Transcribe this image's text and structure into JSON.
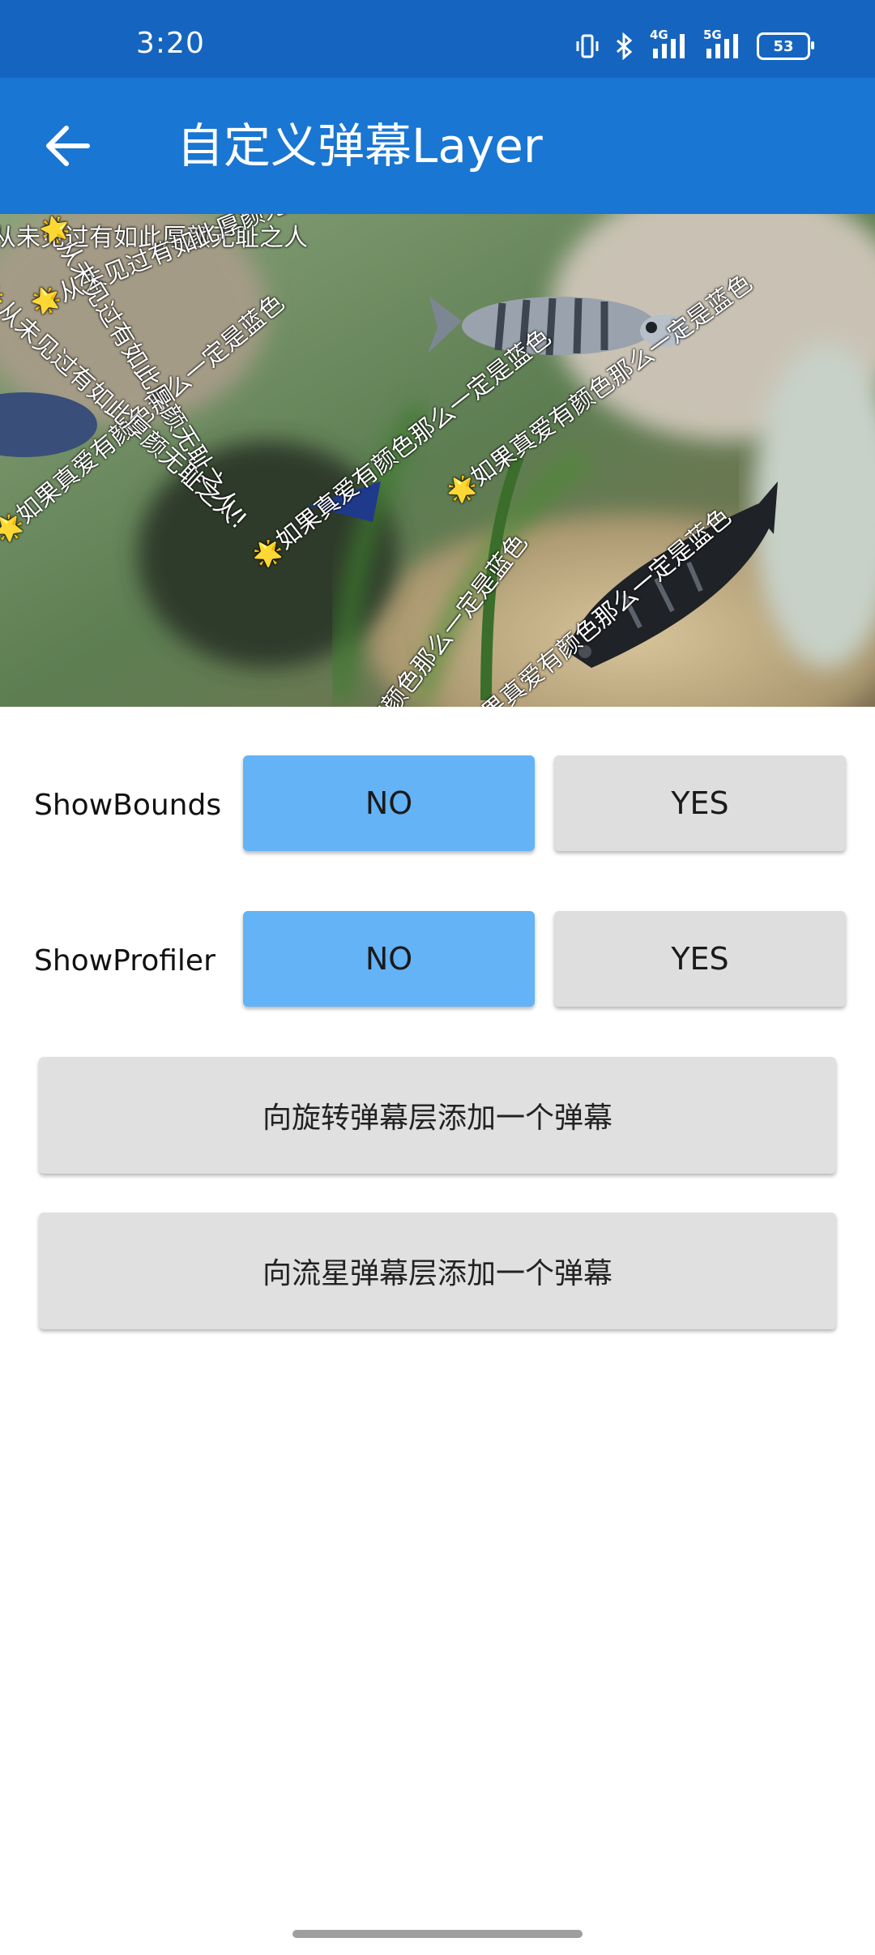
{
  "status_bar": {
    "time": "3:20",
    "icons": [
      "vibrate-icon",
      "bluetooth-icon",
      "signal-4g-icon",
      "signal-5g-icon",
      "battery-icon"
    ],
    "network_a": "4G",
    "network_b": "5G",
    "battery": "53"
  },
  "app_bar": {
    "title": "自定义弹幕Layer",
    "background": "#1976d2",
    "status_color": "#1565c0",
    "back_icon": "arrow-back-icon"
  },
  "video": {
    "danmaku": [
      "从未见过有如此厚颜无耻之人",
      "🌟从未见过有如此厚颜无耻之人!",
      "🌟如果真爱有颜色那么一定是蓝色",
      "🌟如果真爱有颜色那么一定是蓝色",
      "🌟从未见过有如此厚颜无耻之人!",
      "🌟如果真爱有颜色那么一定是蓝色",
      "如果真爱有颜色那么一定是蓝色",
      "🌟从未见过有如此厚颜无耻之人!",
      "有颜色那么一定是蓝色"
    ]
  },
  "settings": {
    "show_bounds": {
      "label": "ShowBounds",
      "no": "NO",
      "yes": "YES",
      "selected": "NO"
    },
    "show_profiler": {
      "label": "ShowProfiler",
      "no": "NO",
      "yes": "YES",
      "selected": "NO"
    }
  },
  "actions": {
    "add_rotate": "向旋转弹幕层添加一个弹幕",
    "add_meteor": "向流星弹幕层添加一个弹幕"
  },
  "colors": {
    "selected_button": "#63b3f6",
    "unselected_button": "#dedede"
  }
}
